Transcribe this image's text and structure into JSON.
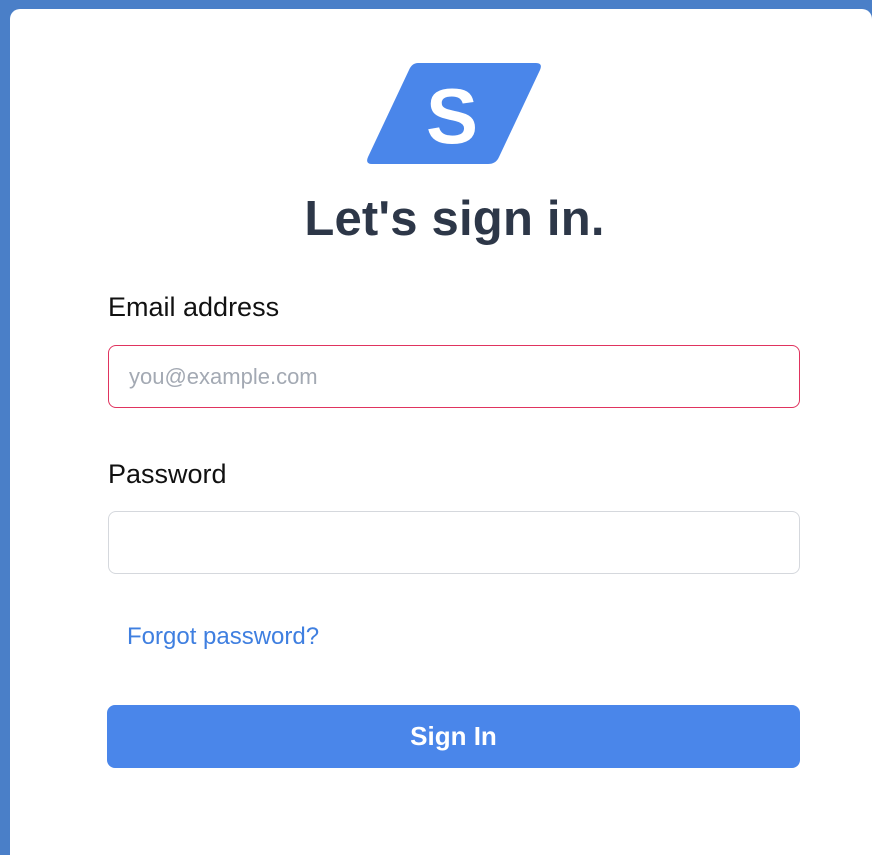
{
  "logo": {
    "letter": "S",
    "icon": "brand-logo-icon",
    "color": "#4a86ea"
  },
  "heading": "Let's sign in.",
  "email": {
    "label": "Email address",
    "value": "",
    "placeholder": "you@example.com",
    "border_color": "#e0345f"
  },
  "password": {
    "label": "Password",
    "value": "",
    "placeholder": ""
  },
  "forgot_link": "Forgot password?",
  "signin_button": "Sign In",
  "colors": {
    "accent": "#4a86ea",
    "link": "#3f7fe0",
    "heading": "#2d3748",
    "frame": "#4a7fc8"
  }
}
